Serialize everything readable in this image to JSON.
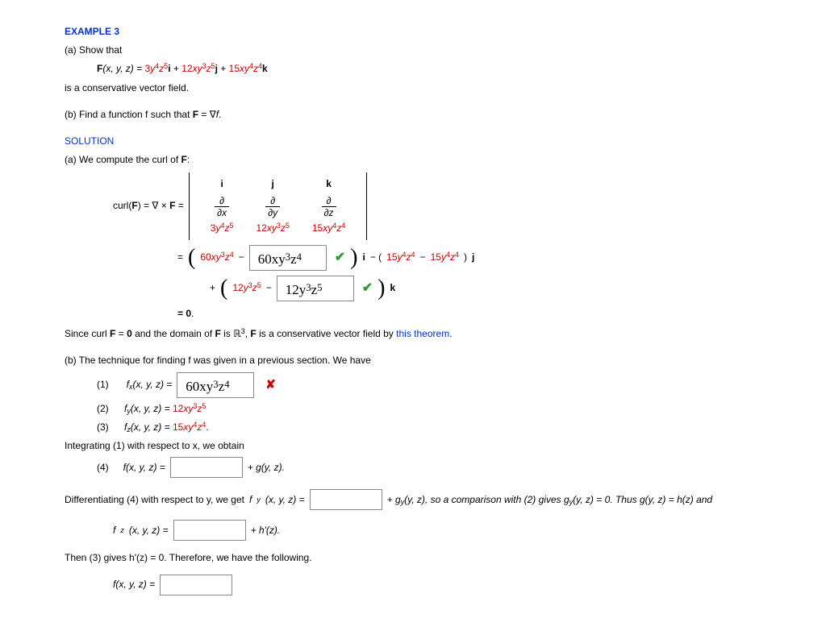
{
  "example_label": "EXAMPLE 3",
  "partA_intro": "(a) Show that",
  "F_def_lhs": "F",
  "F_def_args": "(x, y, z) = ",
  "F_term1_coef": "3",
  "F_term1_vars": "y",
  "F_term1_e1": "4",
  "F_term1_vars2": "z",
  "F_term1_e2": "5",
  "F_unit_i": "i",
  "F_plus": " + ",
  "F_term2_coef": "12",
  "F_term2_vars": "xy",
  "F_term2_e1": "3",
  "F_term2_vars2": "z",
  "F_term2_e2": "5",
  "F_unit_j": "j",
  "F_term3_coef": "15",
  "F_term3_vars": "xy",
  "F_term3_e1": "4",
  "F_term3_vars2": "z",
  "F_term3_e2": "4",
  "F_unit_k": "k",
  "partA_tail": "is a conservative vector field.",
  "partB": "(b) Find a function f such that  ",
  "partB_eq_lhs": "F",
  "partB_eq_mid": " = ∇",
  "partB_eq_rhs": "f",
  "partB_period": ".",
  "solution_label": "SOLUTION",
  "solA_intro": "(a) We compute the curl of ",
  "solA_F": "F",
  "solA_colon": ":",
  "curl_lhs_curl": "curl(",
  "curl_lhs_F": "F",
  "curl_lhs_close": ")   =   ∇ × ",
  "curl_lhs_F2": "F",
  "curl_lhs_eq": " =",
  "det_i": "i",
  "det_j": "j",
  "det_k": "k",
  "det_d": "∂",
  "det_dx": "∂x",
  "det_dy": "∂y",
  "det_dz": "∂z",
  "det_P_a": "3",
  "det_P_b": "y",
  "det_P_e1": "4",
  "det_P_c": "z",
  "det_P_e2": "5",
  "det_Q_a": "12",
  "det_Q_b": "xy",
  "det_Q_e1": "3",
  "det_Q_c": "z",
  "det_Q_e2": "5",
  "det_R_a": "15",
  "det_R_b": "xy",
  "det_R_e1": "4",
  "det_R_c": "z",
  "det_R_e2": "4",
  "line2_eq": " = ",
  "line2_t1_a": "60",
  "line2_t1_b": "xy",
  "line2_t1_e1": "3",
  "line2_t1_c": "z",
  "line2_t1_e2": "4",
  "line2_minus": " − ",
  "box1_value": "60xy",
  "box1_e1": "3",
  "box1_mid": "z",
  "box1_e2": "4",
  "line2_i": "i",
  "line2_sub": " − (",
  "line2_t2a_a": "15",
  "line2_t2a_b": "y",
  "line2_t2a_e1": "4",
  "line2_t2a_c": "z",
  "line2_t2a_e2": "4",
  "line2_t2b_a": "15",
  "line2_t2b_b": "y",
  "line2_t2b_e1": "4",
  "line2_t2b_c": "z",
  "line2_t2b_e2": "4",
  "line2_j_close": ")",
  "line2_j": "j",
  "line3_plus": "+ ",
  "line3_t1_a": "12",
  "line3_t1_b": "y",
  "line3_t1_e1": "3",
  "line3_t1_c": "z",
  "line3_t1_e2": "5",
  "box2_value": "12y",
  "box2_e1": "3",
  "box2_mid": "z",
  "box2_e2": "5",
  "line3_k": "k",
  "line4": " =  0",
  "line4_period": ".",
  "since_1": "Since curl  ",
  "since_F": "F",
  "since_2": " = ",
  "since_zero": "0",
  "since_3": "  and the domain of ",
  "since_F2": "F",
  "since_4": " is ",
  "since_R": "ℝ",
  "since_R_exp": "3",
  "since_5": ", ",
  "since_F3": "F",
  "since_6": " is a conservative vector field by ",
  "since_link": "this theorem",
  "since_period": ".",
  "solB_intro": "(b) The technique for finding f was given in a previous section. We have",
  "eq1_num": "(1)",
  "eq1_lhs_f": "f",
  "eq1_lhs_sub": "x",
  "eq1_lhs_args": "(x, y, z)  =  ",
  "eq2_num": "(2)",
  "eq2_lhs_f": "f",
  "eq2_lhs_sub": "y",
  "eq2_lhs_args": "(x, y, z)  =  ",
  "eq2_rhs_a": "12",
  "eq2_rhs_b": "xy",
  "eq2_rhs_e1": "3",
  "eq2_rhs_c": "z",
  "eq2_rhs_e2": "5",
  "eq3_num": "(3)",
  "eq3_lhs_f": "f",
  "eq3_lhs_sub": "z",
  "eq3_lhs_args": "(x, y, z)  =  ",
  "eq3_rhs_a": "15",
  "eq3_rhs_b": "xy",
  "eq3_rhs_e1": "4",
  "eq3_rhs_c": "z",
  "eq3_rhs_e2": "4",
  "eq3_period": ".",
  "int_text": "Integrating (1) with respect to x, we obtain",
  "eq4_num": "(4)",
  "eq4_lhs": "f(x, y, z)  = ",
  "eq4_tail": "  +  g(y, z).",
  "diff_text_1": "Differentiating (4) with respect to y, we get  ",
  "diff_f": "f",
  "diff_sub": "y",
  "diff_args": "(x, y, z) = ",
  "diff_text_2": "  +  g",
  "diff_gy_sub": "y",
  "diff_text_3": "(y, z),  so a comparison with (2) gives  g",
  "diff_text_4": "(y, z) = 0.  Thus  g(y, z) = h(z)  and",
  "fz_lhs_f": "f",
  "fz_lhs_sub": "z",
  "fz_lhs_args": "(x, y, z)  =  ",
  "fz_tail": "  +  h'(z).",
  "then_text": "Then (3) gives  h'(z) = 0.  Therefore, we have the following.",
  "final_lhs": "f(x, y, z)  =  "
}
